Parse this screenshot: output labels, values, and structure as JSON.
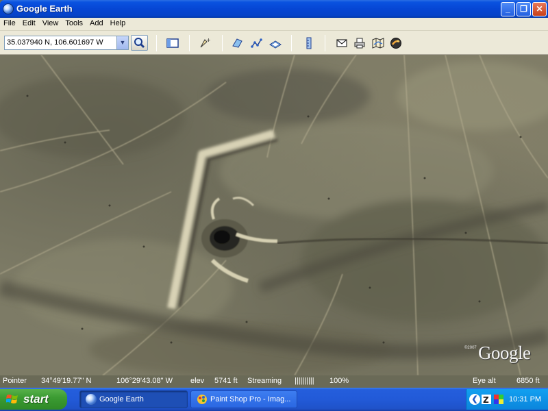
{
  "window": {
    "title": "Google Earth",
    "min": "_",
    "max": "❐",
    "close": "✕"
  },
  "menu": {
    "items": [
      "File",
      "Edit",
      "View",
      "Tools",
      "Add",
      "Help"
    ]
  },
  "toolbar": {
    "coordinates": "35.037940 N, 106.601697 W",
    "dropdown": "▼"
  },
  "map": {
    "copyright": "©2007",
    "logo": "Google"
  },
  "status": {
    "pointer_label": "Pointer",
    "lat": "34°49'19.77\" N",
    "lon": "106°29'43.08\" W",
    "elev_label": "elev",
    "elev_value": "5741 ft",
    "streaming_label": "Streaming",
    "streaming_bar": "||||||||||",
    "streaming_pct": "100%",
    "eye_label": "Eye alt",
    "eye_value": "6850 ft"
  },
  "taskbar": {
    "start": "start",
    "tasks": [
      {
        "label": "Google Earth"
      },
      {
        "label": "Paint Shop Pro - Imag..."
      }
    ],
    "clock": "10:31 PM",
    "tray_chevron": "❮"
  }
}
